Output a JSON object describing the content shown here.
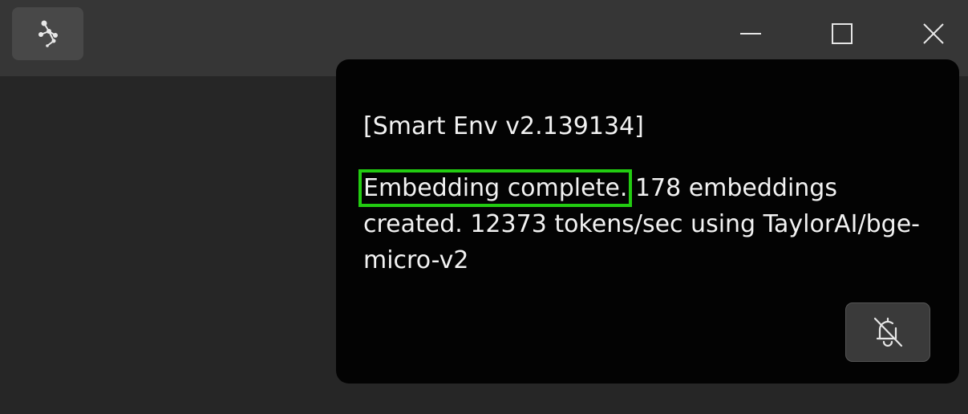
{
  "titlebar": {
    "app_icon": "graph-nodes-icon",
    "window_controls": {
      "minimize_icon": "minimize-icon",
      "maximize_icon": "maximize-icon",
      "close_icon": "close-icon"
    }
  },
  "notice": {
    "header": "[Smart Env v2.139134]",
    "highlight_text": "Embedding complete.",
    "body_text": " 178 embeddings created. 12373 tokens/sec using TaylorAI/bge-micro-v2",
    "mute_button_icon": "bell-off-icon",
    "highlight_color": "#22cc11"
  },
  "colors": {
    "workspace_bg": "#262626",
    "titlebar_bg": "#363636",
    "notice_bg": "#030303",
    "text": "#f2f2f2"
  }
}
